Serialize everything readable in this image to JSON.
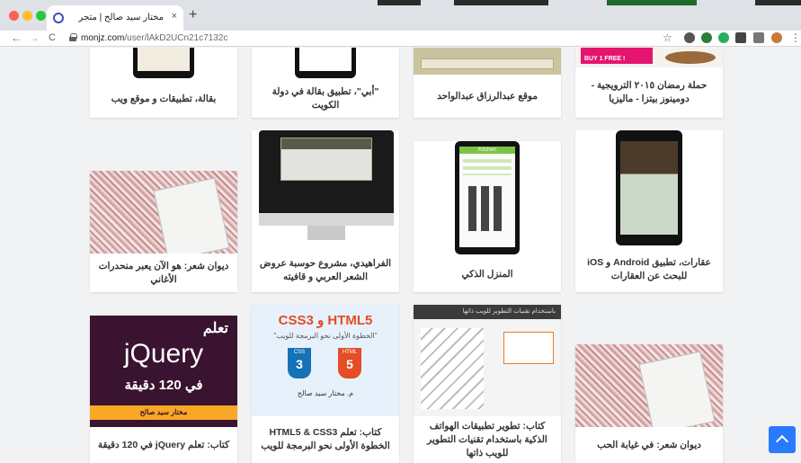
{
  "browser": {
    "tab_title": "مختار سيد صالح | متجر",
    "tab_close": "×",
    "new_tab": "+",
    "nav_back": "←",
    "nav_forward": "→",
    "nav_reload": "C",
    "url_host": "monjz.com",
    "url_path": "/user/lAkD2UCn21c7132c",
    "bookmark_icon": "☆",
    "menu_icon": "⋮"
  },
  "cards_row1": [
    {
      "caption": "حملة رمضان ٢٠١٥ الترويجية - دومينوز بيتزا - ماليزيا"
    },
    {
      "caption": "موقع عبدالرزاق عبدالواحد"
    },
    {
      "caption": "\"أبي\"، تطبيق بقالة في دولة الكويت"
    },
    {
      "caption": "بقالة، تطبيقات و موقع ويب"
    }
  ],
  "cards_row2": [
    {
      "caption": "عقارات، تطبيق Android و iOS للبحث عن العقارات"
    },
    {
      "caption": "المنزل الذكي"
    },
    {
      "caption": "الفراهيدي، مشروع حوسبة عروض الشعر العربي و قافيته"
    },
    {
      "caption": "ديوان شعر: هو الآن يعبر منحدرات الأغاني"
    }
  ],
  "cards_row3": [
    {
      "caption": "ديوان شعر: في غيابة الحب"
    },
    {
      "caption": "كتاب: تطوير تطبيقات الهواتف الذكية باستخدام تقنيات التطوير للويب ذاتها"
    },
    {
      "caption": "كتاب: تعلم HTML5 & CSS3 الخطوة الأولى نحو البرمجة للويب"
    },
    {
      "caption": "كتاب: تعلم jQuery في 120 دقيقة"
    }
  ],
  "thumb_text": {
    "pizza_banner": "BUY 1 FREE !",
    "kitchen_title": "Kitchen",
    "html_heading": "HTML5 و CSS3",
    "html_subtitle": "\"الخطوة الأولى نحو البرمجة للويب\"",
    "html_author": "م. مختار سيد صالح",
    "css_badge": "CSS",
    "html_badge": "HTML",
    "css_num": "3",
    "html_num": "5",
    "jq_learn": "تعلم",
    "jq_word": "jQuery",
    "jq_minutes": "في 120 دقيقة",
    "jq_author": "مختار سيد صالح",
    "mobile_dev_strip": "باستخدام تقنيات التطوير للويب ذاتها"
  },
  "colors": {
    "accent_blue": "#2979ff",
    "page_bg": "#f1f2f4",
    "jquery_bg": "#3a1330",
    "html_bg": "#e6f1fb",
    "kitchen_green": "#7dc242"
  }
}
